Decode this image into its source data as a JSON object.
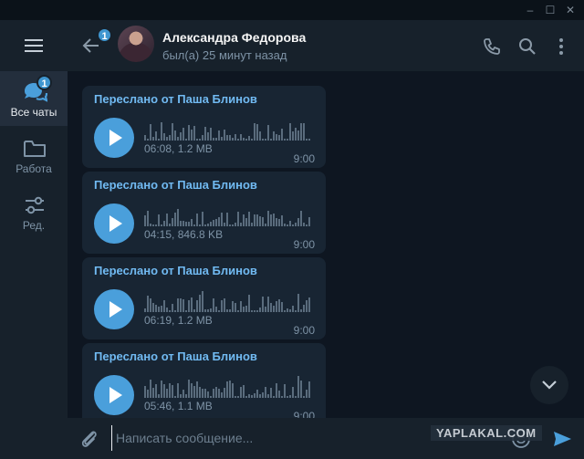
{
  "window": {
    "minimize_glyph": "–",
    "maximize_glyph": "☐",
    "close_glyph": "✕"
  },
  "sidebar": {
    "menu_icon": "hamburger-icon",
    "folders": [
      {
        "label": "Все чаты",
        "icon": "chats-icon",
        "badge": "1",
        "active": true
      },
      {
        "label": "Работа",
        "icon": "folder-icon"
      },
      {
        "label": "Ред.",
        "icon": "sliders-icon"
      }
    ]
  },
  "header": {
    "back_badge": "1",
    "name": "Александра Федорова",
    "status": "был(а) 25 минут назад",
    "icons": [
      "phone-icon",
      "search-icon",
      "more-vertical-icon"
    ]
  },
  "messages": [
    {
      "forwarded_from": "Переслано от Паша Блинов",
      "meta": "06:08, 1.2 MB",
      "time": "9:00",
      "played": 0
    },
    {
      "forwarded_from": "Переслано от Паша Блинов",
      "meta": "04:15, 846.8 KB",
      "time": "9:00",
      "played": 0
    },
    {
      "forwarded_from": "Переслано от Паша Блинов",
      "meta": "06:19, 1.2 MB",
      "time": "9:00",
      "played": 0
    },
    {
      "forwarded_from": "Переслано от Паша Блинов",
      "meta": "05:46, 1.1 MB",
      "time": "9:00",
      "played": 0
    }
  ],
  "composer": {
    "placeholder": "Написать сообщение...",
    "value": ""
  },
  "watermark": "YAPLAKAL.COM",
  "colors": {
    "accent": "#4a9fdb",
    "link": "#71baf2",
    "bubble": "#182533",
    "background": "#0e1621",
    "panel": "#17212b"
  }
}
